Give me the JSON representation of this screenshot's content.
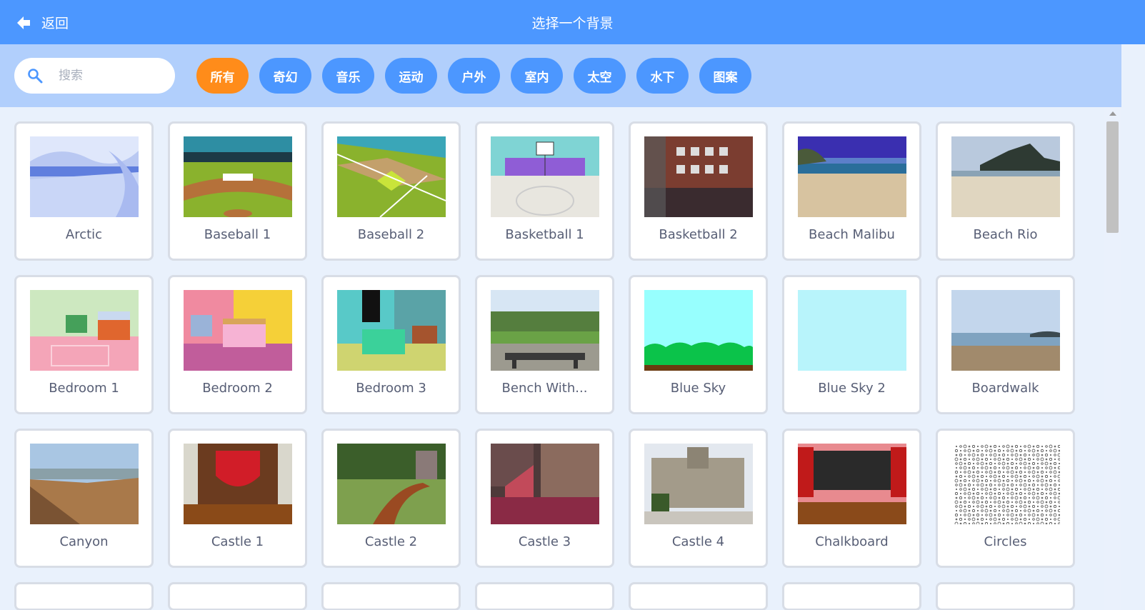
{
  "header": {
    "back_label": "返回",
    "title": "选择一个背景"
  },
  "search": {
    "placeholder": "搜索",
    "value": ""
  },
  "chips": [
    {
      "label": "所有",
      "active": true
    },
    {
      "label": "奇幻"
    },
    {
      "label": "音乐"
    },
    {
      "label": "运动"
    },
    {
      "label": "户外"
    },
    {
      "label": "室内"
    },
    {
      "label": "太空"
    },
    {
      "label": "水下"
    },
    {
      "label": "图案"
    }
  ],
  "backdrops": [
    {
      "name": "Arctic",
      "thumb": "arctic"
    },
    {
      "name": "Baseball 1",
      "thumb": "baseball1"
    },
    {
      "name": "Baseball 2",
      "thumb": "baseball2"
    },
    {
      "name": "Basketball 1",
      "thumb": "basketball1"
    },
    {
      "name": "Basketball 2",
      "thumb": "basketball2"
    },
    {
      "name": "Beach Malibu",
      "thumb": "beach-malibu"
    },
    {
      "name": "Beach Rio",
      "thumb": "beach-rio"
    },
    {
      "name": "Bedroom 1",
      "thumb": "bedroom1"
    },
    {
      "name": "Bedroom 2",
      "thumb": "bedroom2"
    },
    {
      "name": "Bedroom 3",
      "thumb": "bedroom3"
    },
    {
      "name": "Bench With...",
      "thumb": "bench"
    },
    {
      "name": "Blue Sky",
      "thumb": "blue-sky"
    },
    {
      "name": "Blue Sky 2",
      "thumb": "blue-sky-2"
    },
    {
      "name": "Boardwalk",
      "thumb": "boardwalk"
    },
    {
      "name": "Canyon",
      "thumb": "canyon"
    },
    {
      "name": "Castle 1",
      "thumb": "castle1"
    },
    {
      "name": "Castle 2",
      "thumb": "castle2"
    },
    {
      "name": "Castle 3",
      "thumb": "castle3"
    },
    {
      "name": "Castle 4",
      "thumb": "castle4"
    },
    {
      "name": "Chalkboard",
      "thumb": "chalkboard"
    },
    {
      "name": "Circles",
      "thumb": "circles"
    }
  ],
  "colors": {
    "header": "#4c97ff",
    "filterbar": "#b1cffc",
    "active_chip": "#ff8c1a",
    "chip": "#4c97ff",
    "background": "#e9f1fc"
  },
  "icons": {
    "back": "back-arrow-icon",
    "search": "search-icon"
  }
}
